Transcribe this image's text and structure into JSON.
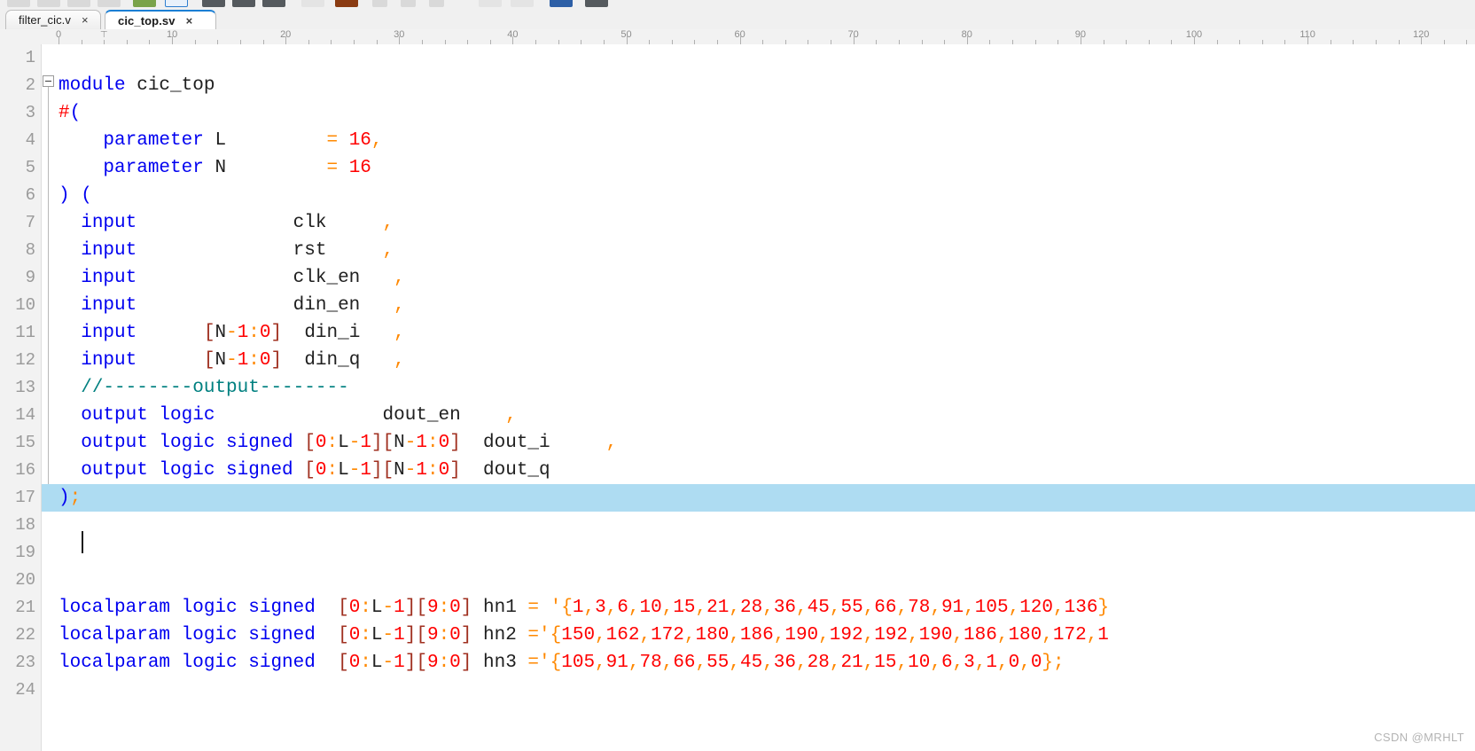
{
  "toolbar": {
    "buttons": [
      {
        "name": "tool-1",
        "kind": "wide"
      },
      {
        "name": "tool-2",
        "kind": "wide"
      },
      {
        "name": "tool-3",
        "kind": "wide"
      },
      {
        "name": "tool-4",
        "kind": "wide"
      },
      {
        "name": "tool-5",
        "kind": "green"
      },
      {
        "name": "tool-6",
        "kind": "sel"
      },
      {
        "name": "tool-7",
        "kind": "dark"
      },
      {
        "name": "tool-8",
        "kind": "dark"
      },
      {
        "name": "tool-9",
        "kind": "dark"
      },
      {
        "name": "tool-10",
        "kind": "light"
      },
      {
        "name": "tool-11",
        "kind": "brown"
      },
      {
        "name": "tool-12",
        "kind": "narrow"
      },
      {
        "name": "tool-13",
        "kind": "narrow"
      },
      {
        "name": "tool-14",
        "kind": "narrow"
      },
      {
        "name": "tool-15",
        "kind": "light"
      },
      {
        "name": "tool-16",
        "kind": "light"
      },
      {
        "name": "tool-17",
        "kind": "blue"
      },
      {
        "name": "tool-18",
        "kind": "dark"
      }
    ]
  },
  "tabs": [
    {
      "label": "filter_cic.v",
      "close": "×",
      "active": false
    },
    {
      "label": "cic_top.sv",
      "close": "×",
      "active": true
    }
  ],
  "ruler": {
    "labels": [
      "0",
      "10",
      "20",
      "30",
      "40",
      "50",
      "60",
      "70",
      "80",
      "90"
    ],
    "caret_marker": "⊤"
  },
  "editor": {
    "language": "SystemVerilog",
    "highlighted_line": 17,
    "colors": {
      "keyword": "#0000f0",
      "number": "#ff0000",
      "operator": "#ff8800",
      "bracket": "#a03020",
      "comment": "#008080",
      "identifier": "#202020",
      "line_highlight": "#aedcf2",
      "gutter_bg": "#f2f2f2",
      "line_number": "#9a9a9a",
      "background": "#ffffff"
    },
    "lines": [
      {
        "n": "1",
        "tokens": []
      },
      {
        "n": "2",
        "tokens": [
          [
            "kw",
            "module"
          ],
          [
            "id",
            " cic_top"
          ]
        ]
      },
      {
        "n": "3",
        "tokens": [
          [
            "pre",
            "#"
          ],
          [
            "punct",
            "("
          ]
        ]
      },
      {
        "n": "4",
        "tokens": [
          [
            "id",
            "    "
          ],
          [
            "kw",
            "parameter"
          ],
          [
            "id",
            " L         "
          ],
          [
            "op",
            "="
          ],
          [
            "id",
            " "
          ],
          [
            "num",
            "16"
          ],
          [
            "op",
            ","
          ]
        ]
      },
      {
        "n": "5",
        "tokens": [
          [
            "id",
            "    "
          ],
          [
            "kw",
            "parameter"
          ],
          [
            "id",
            " N         "
          ],
          [
            "op",
            "="
          ],
          [
            "id",
            " "
          ],
          [
            "num",
            "16"
          ]
        ]
      },
      {
        "n": "6",
        "tokens": [
          [
            "punct",
            ")"
          ],
          [
            "id",
            " "
          ],
          [
            "punct",
            "("
          ]
        ]
      },
      {
        "n": "7",
        "tokens": [
          [
            "id",
            "  "
          ],
          [
            "kw",
            "input"
          ],
          [
            "id",
            "              clk     "
          ],
          [
            "op",
            ","
          ]
        ]
      },
      {
        "n": "8",
        "tokens": [
          [
            "id",
            "  "
          ],
          [
            "kw",
            "input"
          ],
          [
            "id",
            "              rst     "
          ],
          [
            "op",
            ","
          ]
        ]
      },
      {
        "n": "9",
        "tokens": [
          [
            "id",
            "  "
          ],
          [
            "kw",
            "input"
          ],
          [
            "id",
            "              clk_en   "
          ],
          [
            "op",
            ","
          ]
        ]
      },
      {
        "n": "10",
        "tokens": [
          [
            "id",
            "  "
          ],
          [
            "kw",
            "input"
          ],
          [
            "id",
            "              din_en   "
          ],
          [
            "op",
            ","
          ]
        ]
      },
      {
        "n": "11",
        "tokens": [
          [
            "id",
            "  "
          ],
          [
            "kw",
            "input"
          ],
          [
            "id",
            "      "
          ],
          [
            "brk",
            "["
          ],
          [
            "id",
            "N"
          ],
          [
            "op",
            "-"
          ],
          [
            "num",
            "1"
          ],
          [
            "op",
            ":"
          ],
          [
            "num",
            "0"
          ],
          [
            "brk",
            "]"
          ],
          [
            "id",
            "  din_i   "
          ],
          [
            "op",
            ","
          ]
        ]
      },
      {
        "n": "12",
        "tokens": [
          [
            "id",
            "  "
          ],
          [
            "kw",
            "input"
          ],
          [
            "id",
            "      "
          ],
          [
            "brk",
            "["
          ],
          [
            "id",
            "N"
          ],
          [
            "op",
            "-"
          ],
          [
            "num",
            "1"
          ],
          [
            "op",
            ":"
          ],
          [
            "num",
            "0"
          ],
          [
            "brk",
            "]"
          ],
          [
            "id",
            "  din_q   "
          ],
          [
            "op",
            ","
          ]
        ]
      },
      {
        "n": "13",
        "tokens": [
          [
            "id",
            "  "
          ],
          [
            "cmt",
            "//--------output--------"
          ]
        ]
      },
      {
        "n": "14",
        "tokens": [
          [
            "id",
            "  "
          ],
          [
            "kw",
            "output logic"
          ],
          [
            "id",
            "               dout_en    "
          ],
          [
            "op",
            ","
          ]
        ]
      },
      {
        "n": "15",
        "tokens": [
          [
            "id",
            "  "
          ],
          [
            "kw",
            "output logic signed"
          ],
          [
            "id",
            " "
          ],
          [
            "brk",
            "["
          ],
          [
            "num",
            "0"
          ],
          [
            "op",
            ":"
          ],
          [
            "id",
            "L"
          ],
          [
            "op",
            "-"
          ],
          [
            "num",
            "1"
          ],
          [
            "brk",
            "]"
          ],
          [
            "brk",
            "["
          ],
          [
            "id",
            "N"
          ],
          [
            "op",
            "-"
          ],
          [
            "num",
            "1"
          ],
          [
            "op",
            ":"
          ],
          [
            "num",
            "0"
          ],
          [
            "brk",
            "]"
          ],
          [
            "id",
            "  dout_i     "
          ],
          [
            "op",
            ","
          ]
        ]
      },
      {
        "n": "16",
        "tokens": [
          [
            "id",
            "  "
          ],
          [
            "kw",
            "output logic signed"
          ],
          [
            "id",
            " "
          ],
          [
            "brk",
            "["
          ],
          [
            "num",
            "0"
          ],
          [
            "op",
            ":"
          ],
          [
            "id",
            "L"
          ],
          [
            "op",
            "-"
          ],
          [
            "num",
            "1"
          ],
          [
            "brk",
            "]"
          ],
          [
            "brk",
            "["
          ],
          [
            "id",
            "N"
          ],
          [
            "op",
            "-"
          ],
          [
            "num",
            "1"
          ],
          [
            "op",
            ":"
          ],
          [
            "num",
            "0"
          ],
          [
            "brk",
            "]"
          ],
          [
            "id",
            "  dout_q"
          ]
        ]
      },
      {
        "n": "17",
        "tokens": [
          [
            "punct",
            ")"
          ],
          [
            "op",
            ";"
          ]
        ]
      },
      {
        "n": "18",
        "tokens": []
      },
      {
        "n": "19",
        "tokens": []
      },
      {
        "n": "20",
        "tokens": []
      },
      {
        "n": "21",
        "tokens": [
          [
            "kw",
            "localparam logic signed"
          ],
          [
            "id",
            "  "
          ],
          [
            "brk",
            "["
          ],
          [
            "num",
            "0"
          ],
          [
            "op",
            ":"
          ],
          [
            "id",
            "L"
          ],
          [
            "op",
            "-"
          ],
          [
            "num",
            "1"
          ],
          [
            "brk",
            "]"
          ],
          [
            "brk",
            "["
          ],
          [
            "num",
            "9"
          ],
          [
            "op",
            ":"
          ],
          [
            "num",
            "0"
          ],
          [
            "brk",
            "]"
          ],
          [
            "id",
            " hn1 "
          ],
          [
            "op",
            "="
          ],
          [
            "id",
            " "
          ],
          [
            "op",
            "'"
          ],
          [
            "op",
            "{"
          ],
          [
            "num",
            "1"
          ],
          [
            "op",
            ","
          ],
          [
            "num",
            "3"
          ],
          [
            "op",
            ","
          ],
          [
            "num",
            "6"
          ],
          [
            "op",
            ","
          ],
          [
            "num",
            "10"
          ],
          [
            "op",
            ","
          ],
          [
            "num",
            "15"
          ],
          [
            "op",
            ","
          ],
          [
            "num",
            "21"
          ],
          [
            "op",
            ","
          ],
          [
            "num",
            "28"
          ],
          [
            "op",
            ","
          ],
          [
            "num",
            "36"
          ],
          [
            "op",
            ","
          ],
          [
            "num",
            "45"
          ],
          [
            "op",
            ","
          ],
          [
            "num",
            "55"
          ],
          [
            "op",
            ","
          ],
          [
            "num",
            "66"
          ],
          [
            "op",
            ","
          ],
          [
            "num",
            "78"
          ],
          [
            "op",
            ","
          ],
          [
            "num",
            "91"
          ],
          [
            "op",
            ","
          ],
          [
            "num",
            "105"
          ],
          [
            "op",
            ","
          ],
          [
            "num",
            "120"
          ],
          [
            "op",
            ","
          ],
          [
            "num",
            "136"
          ],
          [
            "op",
            "}"
          ]
        ]
      },
      {
        "n": "22",
        "tokens": [
          [
            "kw",
            "localparam logic signed"
          ],
          [
            "id",
            "  "
          ],
          [
            "brk",
            "["
          ],
          [
            "num",
            "0"
          ],
          [
            "op",
            ":"
          ],
          [
            "id",
            "L"
          ],
          [
            "op",
            "-"
          ],
          [
            "num",
            "1"
          ],
          [
            "brk",
            "]"
          ],
          [
            "brk",
            "["
          ],
          [
            "num",
            "9"
          ],
          [
            "op",
            ":"
          ],
          [
            "num",
            "0"
          ],
          [
            "brk",
            "]"
          ],
          [
            "id",
            " hn2 "
          ],
          [
            "op",
            "='"
          ],
          [
            "op",
            "{"
          ],
          [
            "num",
            "150"
          ],
          [
            "op",
            ","
          ],
          [
            "num",
            "162"
          ],
          [
            "op",
            ","
          ],
          [
            "num",
            "172"
          ],
          [
            "op",
            ","
          ],
          [
            "num",
            "180"
          ],
          [
            "op",
            ","
          ],
          [
            "num",
            "186"
          ],
          [
            "op",
            ","
          ],
          [
            "num",
            "190"
          ],
          [
            "op",
            ","
          ],
          [
            "num",
            "192"
          ],
          [
            "op",
            ","
          ],
          [
            "num",
            "192"
          ],
          [
            "op",
            ","
          ],
          [
            "num",
            "190"
          ],
          [
            "op",
            ","
          ],
          [
            "num",
            "186"
          ],
          [
            "op",
            ","
          ],
          [
            "num",
            "180"
          ],
          [
            "op",
            ","
          ],
          [
            "num",
            "172"
          ],
          [
            "op",
            ","
          ],
          [
            "num",
            "1"
          ]
        ]
      },
      {
        "n": "23",
        "tokens": [
          [
            "kw",
            "localparam logic signed"
          ],
          [
            "id",
            "  "
          ],
          [
            "brk",
            "["
          ],
          [
            "num",
            "0"
          ],
          [
            "op",
            ":"
          ],
          [
            "id",
            "L"
          ],
          [
            "op",
            "-"
          ],
          [
            "num",
            "1"
          ],
          [
            "brk",
            "]"
          ],
          [
            "brk",
            "["
          ],
          [
            "num",
            "9"
          ],
          [
            "op",
            ":"
          ],
          [
            "num",
            "0"
          ],
          [
            "brk",
            "]"
          ],
          [
            "id",
            " hn3 "
          ],
          [
            "op",
            "='"
          ],
          [
            "op",
            "{"
          ],
          [
            "num",
            "105"
          ],
          [
            "op",
            ","
          ],
          [
            "num",
            "91"
          ],
          [
            "op",
            ","
          ],
          [
            "num",
            "78"
          ],
          [
            "op",
            ","
          ],
          [
            "num",
            "66"
          ],
          [
            "op",
            ","
          ],
          [
            "num",
            "55"
          ],
          [
            "op",
            ","
          ],
          [
            "num",
            "45"
          ],
          [
            "op",
            ","
          ],
          [
            "num",
            "36"
          ],
          [
            "op",
            ","
          ],
          [
            "num",
            "28"
          ],
          [
            "op",
            ","
          ],
          [
            "num",
            "21"
          ],
          [
            "op",
            ","
          ],
          [
            "num",
            "15"
          ],
          [
            "op",
            ","
          ],
          [
            "num",
            "10"
          ],
          [
            "op",
            ","
          ],
          [
            "num",
            "6"
          ],
          [
            "op",
            ","
          ],
          [
            "num",
            "3"
          ],
          [
            "op",
            ","
          ],
          [
            "num",
            "1"
          ],
          [
            "op",
            ","
          ],
          [
            "num",
            "0"
          ],
          [
            "op",
            ","
          ],
          [
            "num",
            "0"
          ],
          [
            "op",
            "}"
          ],
          [
            "op",
            ";"
          ]
        ]
      },
      {
        "n": "24",
        "tokens": []
      }
    ]
  },
  "watermark": {
    "text": "CSDN @MRHLT"
  }
}
